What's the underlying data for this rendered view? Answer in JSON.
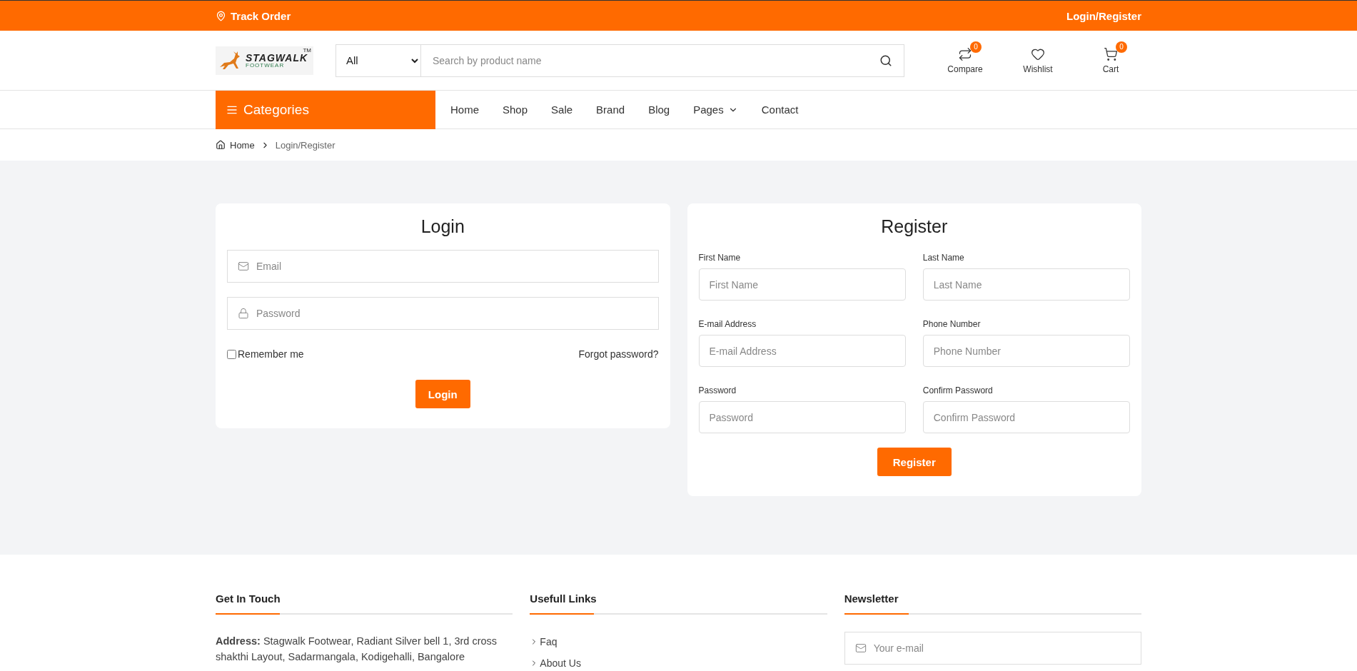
{
  "top_bar": {
    "track_order": "Track Order",
    "login_register": "Login/Register"
  },
  "header": {
    "logo": {
      "name": "STAGWALK",
      "tm": "TM",
      "sub": "FOOTWEAR"
    },
    "search": {
      "category": "All",
      "placeholder": "Search by product name"
    },
    "actions": [
      {
        "kind": "compare",
        "label": "Compare",
        "count": "0"
      },
      {
        "kind": "wishlist",
        "label": "Wishlist"
      },
      {
        "kind": "cart",
        "label": "Cart",
        "count": "0"
      }
    ]
  },
  "nav": {
    "categories": "Categories",
    "items": [
      {
        "label": "Home",
        "dropdown": false
      },
      {
        "label": "Shop",
        "dropdown": false
      },
      {
        "label": "Sale",
        "dropdown": false
      },
      {
        "label": "Brand",
        "dropdown": false
      },
      {
        "label": "Blog",
        "dropdown": false
      },
      {
        "label": "Pages",
        "dropdown": true
      },
      {
        "label": "Contact",
        "dropdown": false
      }
    ]
  },
  "breadcrumb": [
    "Home",
    "Login/Register"
  ],
  "login": {
    "title": "Login",
    "fields": [
      {
        "kind": "email",
        "placeholder": "Email"
      },
      {
        "kind": "password",
        "placeholder": "Password"
      }
    ],
    "remember": {
      "label": "Remember me",
      "checked": false
    },
    "forgot": "Forgot password?",
    "button": "Login"
  },
  "register": {
    "title": "Register",
    "fields": [
      {
        "label": "First Name",
        "placeholder": "First Name"
      },
      {
        "label": "Last Name",
        "placeholder": "Last Name"
      },
      {
        "label": "E-mail Address",
        "placeholder": "E-mail Address"
      },
      {
        "label": "Phone Number",
        "placeholder": "Phone Number"
      },
      {
        "label": "Password",
        "placeholder": "Password"
      },
      {
        "label": "Confirm Password",
        "placeholder": "Confirm Password"
      }
    ],
    "button": "Register"
  },
  "footer": {
    "get_in_touch": {
      "title": "Get In Touch",
      "address": "**Address:** Stagwalk Footwear, Radiant Silver bell 1, 3rd cross shakthi Layout, Sadarmangala, Kodigehalli, Bangalore"
    },
    "links": {
      "title": "Usefull Links",
      "items": [
        "Faq",
        "About Us"
      ]
    },
    "newsletter": {
      "title": "Newsletter",
      "placeholder": "Your e-mail"
    }
  }
}
